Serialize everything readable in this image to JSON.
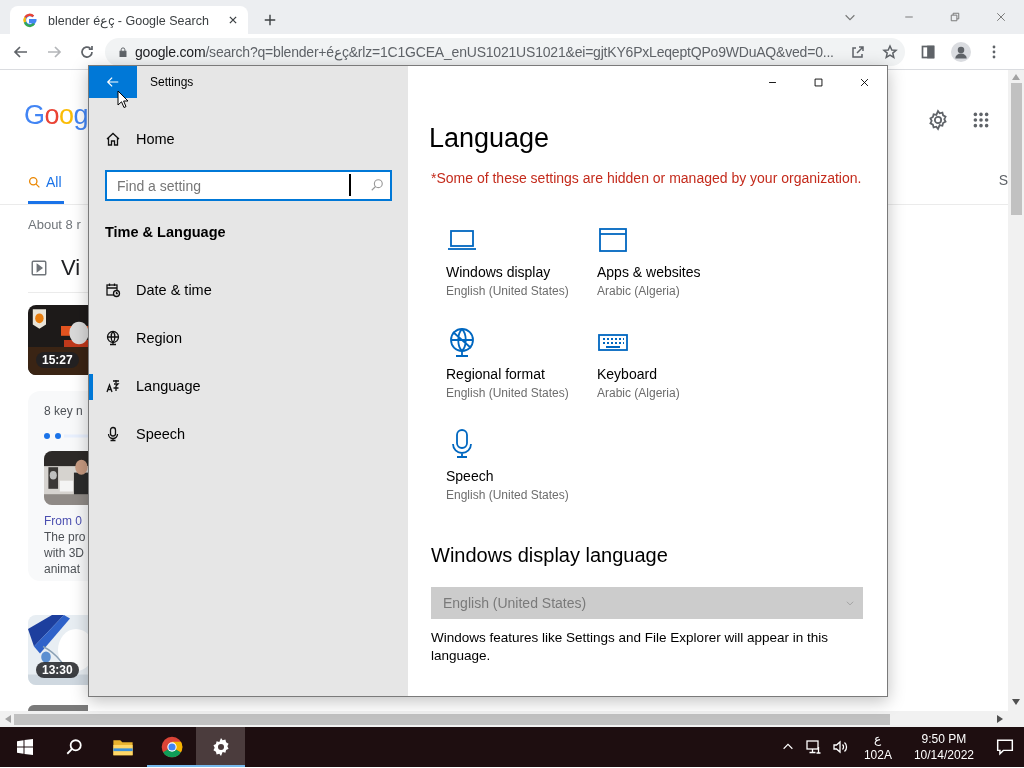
{
  "browser": {
    "tabs": [
      {
        "title": "blender éعç - Google Search",
        "selected": true
      }
    ],
    "forward_disabled": true,
    "address": {
      "host": "google.com",
      "path": "/search?q=blender+éعç&rlz=1C1GCEA_enUS1021US1021&ei=gjtKY6PxLeqeptQPo9WDuAQ&ved=0..."
    }
  },
  "google_page": {
    "logo": "Goog",
    "tabs": [
      {
        "label": "All",
        "selected": true
      }
    ],
    "tab_fragment": "S",
    "result_stats": "About 8 r",
    "section_title": "Vi",
    "results": [
      {
        "kind": "video",
        "duration": "15:27"
      },
      {
        "kind": "key_moments",
        "title": "8 key n",
        "link": "From 0",
        "snippet_lines": [
          "The pro",
          "with 3D",
          "animat"
        ]
      },
      {
        "kind": "video",
        "duration": "13:30"
      },
      {
        "kind": "video"
      }
    ]
  },
  "settings_window": {
    "title": "Settings",
    "home": "Home",
    "search": {
      "placeholder": "Find a setting"
    },
    "section": "Time & Language",
    "nav": [
      {
        "label": "Date & time",
        "kind": "datetime",
        "selected": false
      },
      {
        "label": "Region",
        "kind": "region",
        "selected": false
      },
      {
        "label": "Language",
        "kind": "language",
        "selected": true
      },
      {
        "label": "Speech",
        "kind": "speech",
        "selected": false
      }
    ],
    "page": {
      "title": "Language",
      "notice": "*Some of these settings are hidden or managed by your organization.",
      "tiles": [
        {
          "kind": "display",
          "title": "Windows display",
          "subtitle": "English (United States)"
        },
        {
          "kind": "apps",
          "title": "Apps & websites",
          "subtitle": "Arabic (Algeria)"
        },
        {
          "kind": "region",
          "title": "Regional format",
          "subtitle": "English (United States)"
        },
        {
          "kind": "keyboard",
          "title": "Keyboard",
          "subtitle": "Arabic (Algeria)"
        },
        {
          "kind": "speech",
          "title": "Speech",
          "subtitle": "English (United States)"
        }
      ],
      "display_language": {
        "heading": "Windows display language",
        "dropdown": {
          "value": "English (United States)",
          "disabled": true
        },
        "description": "Windows features like Settings and File Explorer will appear in this language."
      }
    }
  },
  "taskbar": {
    "apps": [
      {
        "kind": "explorer",
        "running": false,
        "selected": false
      },
      {
        "kind": "chrome",
        "running": true,
        "selected": false
      },
      {
        "kind": "settings",
        "running": true,
        "selected": true
      }
    ],
    "input_indicator": {
      "script": "ع",
      "layout": "102A"
    },
    "clock": {
      "time": "9:50 PM",
      "date": "10/14/2022"
    }
  }
}
